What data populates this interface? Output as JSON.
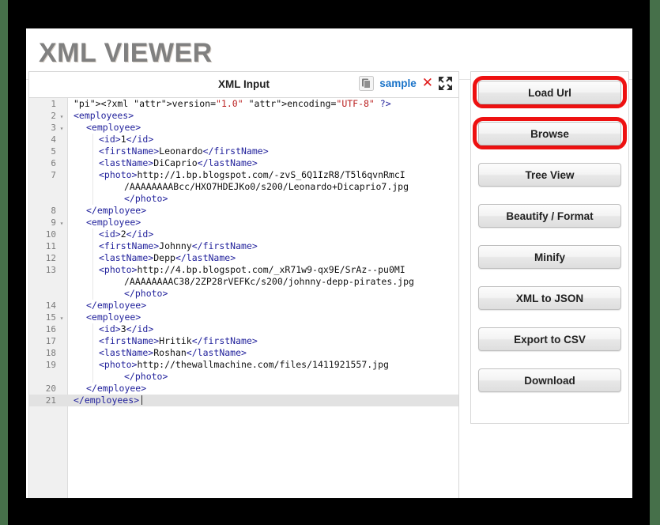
{
  "app": {
    "title": "XML VIEWER",
    "frame_border_color": "#000000",
    "outer_background": "#46704a",
    "highlight_color": "#ee1111",
    "link_color": "#1a73c8"
  },
  "editor": {
    "panel_title": "XML Input",
    "toolbar": {
      "copy_icon": "copy-icon",
      "sample_label": "sample",
      "clear_icon": "close-icon",
      "expand_icon": "fullscreen-icon"
    },
    "active_line": 21,
    "lines": [
      {
        "n": "1",
        "fold": "",
        "indent": 0,
        "text": "<?xml version=\"1.0\" encoding=\"UTF-8\" ?>"
      },
      {
        "n": "2",
        "fold": "▾",
        "indent": 0,
        "text": "<employees>"
      },
      {
        "n": "3",
        "fold": "▾",
        "indent": 1,
        "text": "<employee>"
      },
      {
        "n": "4",
        "fold": "",
        "indent": 2,
        "text": "<id>1</id>"
      },
      {
        "n": "5",
        "fold": "",
        "indent": 2,
        "text": "<firstName>Leonardo</firstName>"
      },
      {
        "n": "6",
        "fold": "",
        "indent": 2,
        "text": "<lastName>DiCaprio</lastName>"
      },
      {
        "n": "7",
        "fold": "",
        "indent": 2,
        "text": "<photo>http://1.bp.blogspot.com/-zvS_6Q1IzR8/T5l6qvnRmcI"
      },
      {
        "n": "",
        "fold": "",
        "indent": 4,
        "text": "/AAAAAAAABcc/HXO7HDEJKo0/s200/Leonardo+Dicaprio7.jpg"
      },
      {
        "n": "",
        "fold": "",
        "indent": 4,
        "text": "</photo>"
      },
      {
        "n": "8",
        "fold": "",
        "indent": 1,
        "text": "</employee>"
      },
      {
        "n": "9",
        "fold": "▾",
        "indent": 1,
        "text": "<employee>"
      },
      {
        "n": "10",
        "fold": "",
        "indent": 2,
        "text": "<id>2</id>"
      },
      {
        "n": "11",
        "fold": "",
        "indent": 2,
        "text": "<firstName>Johnny</firstName>"
      },
      {
        "n": "12",
        "fold": "",
        "indent": 2,
        "text": "<lastName>Depp</lastName>"
      },
      {
        "n": "13",
        "fold": "",
        "indent": 2,
        "text": "<photo>http://4.bp.blogspot.com/_xR71w9-qx9E/SrAz--pu0MI"
      },
      {
        "n": "",
        "fold": "",
        "indent": 4,
        "text": "/AAAAAAAAC38/2ZP28rVEFKc/s200/johnny-depp-pirates.jpg"
      },
      {
        "n": "",
        "fold": "",
        "indent": 4,
        "text": "</photo>"
      },
      {
        "n": "14",
        "fold": "",
        "indent": 1,
        "text": "</employee>"
      },
      {
        "n": "15",
        "fold": "▾",
        "indent": 1,
        "text": "<employee>"
      },
      {
        "n": "16",
        "fold": "",
        "indent": 2,
        "text": "<id>3</id>"
      },
      {
        "n": "17",
        "fold": "",
        "indent": 2,
        "text": "<firstName>Hritik</firstName>"
      },
      {
        "n": "18",
        "fold": "",
        "indent": 2,
        "text": "<lastName>Roshan</lastName>"
      },
      {
        "n": "19",
        "fold": "",
        "indent": 2,
        "text": "<photo>http://thewallmachine.com/files/1411921557.jpg"
      },
      {
        "n": "",
        "fold": "",
        "indent": 4,
        "text": "</photo>"
      },
      {
        "n": "20",
        "fold": "",
        "indent": 1,
        "text": "</employee>"
      },
      {
        "n": "21",
        "fold": "",
        "indent": 0,
        "text": "</employees>"
      }
    ]
  },
  "sidebar": {
    "buttons": [
      {
        "label": "Load Url",
        "highlighted": true
      },
      {
        "label": "Browse",
        "highlighted": true
      },
      {
        "label": "Tree View",
        "highlighted": false
      },
      {
        "label": "Beautify / Format",
        "highlighted": false
      },
      {
        "label": "Minify",
        "highlighted": false
      },
      {
        "label": "XML to JSON",
        "highlighted": false
      },
      {
        "label": "Export to CSV",
        "highlighted": false
      },
      {
        "label": "Download",
        "highlighted": false
      }
    ]
  }
}
